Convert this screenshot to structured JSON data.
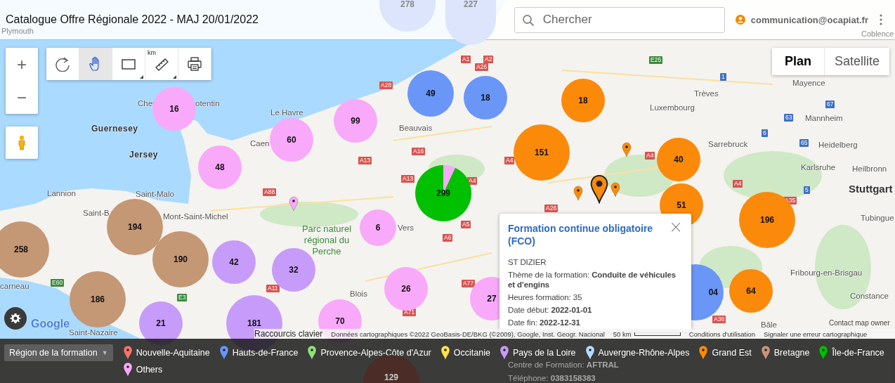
{
  "header": {
    "title": "Catalogue Offre Régionale 2022 - MAJ 20/01/2022",
    "search": {
      "placeholder": "Chercher"
    },
    "user": "communication@ocapiat.fr"
  },
  "map_controls": {
    "zoom_in": "+",
    "zoom_out": "−",
    "tools": [
      {
        "kind": "refresh",
        "selected": false
      },
      {
        "kind": "hand",
        "selected": true
      },
      {
        "kind": "rectangle",
        "selected": false
      },
      {
        "kind": "ruler",
        "label": "km",
        "selected": false
      },
      {
        "kind": "print",
        "selected": false
      }
    ],
    "map_types": [
      {
        "label": "Plan",
        "selected": true
      },
      {
        "label": "Satellite",
        "selected": false
      }
    ]
  },
  "map_labels": [
    {
      "kind": "faded_city",
      "text": "Plymouth"
    },
    {
      "kind": "faded_city",
      "text": "Coblence"
    },
    {
      "kind": "city",
      "text": "Mayence"
    },
    {
      "kind": "city",
      "text": "Trèves"
    },
    {
      "kind": "city",
      "text": "Cher"
    },
    {
      "kind": "city",
      "text": "otentin"
    },
    {
      "kind": "city",
      "text": "Le Havre"
    },
    {
      "kind": "city",
      "text": "Luxembourg"
    },
    {
      "kind": "city",
      "text": "Mannheim"
    },
    {
      "kind": "island",
      "text": "Guernesey"
    },
    {
      "kind": "city",
      "text": "Beauvais"
    },
    {
      "kind": "city",
      "text": "Caen"
    },
    {
      "kind": "city",
      "text": "Sarrebruck"
    },
    {
      "kind": "city",
      "text": "Heidelberg"
    },
    {
      "kind": "island",
      "text": "Jersey"
    },
    {
      "kind": "city",
      "text": "Karlsruhe"
    },
    {
      "kind": "city",
      "text": "Heilbronn"
    },
    {
      "kind": "city",
      "text": "Lannion"
    },
    {
      "kind": "city",
      "text": "Saint-Malo"
    },
    {
      "kind": "capital",
      "text": "Stuttgart"
    },
    {
      "kind": "city",
      "text": "Saint-B"
    },
    {
      "kind": "city",
      "text": "Mont-Saint-Michel"
    },
    {
      "kind": "city",
      "text": "Tubingue"
    },
    {
      "kind": "park",
      "text": "Parc naturel régional du Perche"
    },
    {
      "kind": "city",
      "text": "Vers"
    },
    {
      "kind": "city",
      "text": "Fribourg-en-Brisgau"
    },
    {
      "kind": "city",
      "text": "carneau"
    },
    {
      "kind": "city",
      "text": "Blois"
    },
    {
      "kind": "city",
      "text": "Constance"
    },
    {
      "kind": "city",
      "text": "Saint-Nazaire"
    },
    {
      "kind": "city",
      "text": "Bâle"
    }
  ],
  "road_shields": [
    {
      "kind": "road",
      "text": "A1"
    },
    {
      "kind": "road",
      "text": "A2"
    },
    {
      "kind": "euro",
      "text": "E25"
    },
    {
      "kind": "road",
      "text": "A26"
    },
    {
      "kind": "autobahn",
      "text": "1"
    },
    {
      "kind": "road",
      "text": "A28"
    },
    {
      "kind": "autobahn",
      "text": "67"
    },
    {
      "kind": "autobahn",
      "text": "63"
    },
    {
      "kind": "autobahn",
      "text": "6"
    },
    {
      "kind": "autobahn",
      "text": "65"
    },
    {
      "kind": "road",
      "text": "A16"
    },
    {
      "kind": "road",
      "text": "A13"
    },
    {
      "kind": "road",
      "text": "A4"
    },
    {
      "kind": "road",
      "text": "A4"
    },
    {
      "kind": "road",
      "text": "A13"
    },
    {
      "kind": "road",
      "text": "A4"
    },
    {
      "kind": "road",
      "text": "A4"
    },
    {
      "kind": "road",
      "text": "A88"
    },
    {
      "kind": "autobahn",
      "text": "5"
    },
    {
      "kind": "road",
      "text": "A35"
    },
    {
      "kind": "road",
      "text": "A26"
    },
    {
      "kind": "road",
      "text": "A5"
    },
    {
      "kind": "road",
      "text": "A6"
    },
    {
      "kind": "euro",
      "text": "E60"
    },
    {
      "kind": "road",
      "text": "A11"
    },
    {
      "kind": "road",
      "text": "A77"
    },
    {
      "kind": "euro",
      "text": "E3"
    },
    {
      "kind": "road",
      "text": "A71"
    },
    {
      "kind": "road",
      "text": "A36"
    }
  ],
  "clusters": [
    {
      "kind": "faded",
      "label": "278",
      "color": "#dce5fb"
    },
    {
      "kind": "faded",
      "label": "227",
      "color": "#dce5fb"
    },
    {
      "kind": "single",
      "label": "49",
      "color": "#6a96f8"
    },
    {
      "kind": "single",
      "label": "18",
      "color": "#6a96f8"
    },
    {
      "kind": "single",
      "label": "18",
      "color": "#fb8a0a"
    },
    {
      "kind": "single",
      "label": "16",
      "color": "#f9a9f9"
    },
    {
      "kind": "single",
      "label": "99",
      "color": "#f9a9f9"
    },
    {
      "kind": "single",
      "label": "60",
      "color": "#f9a9f9"
    },
    {
      "kind": "single",
      "label": "151",
      "color": "#fb8a0a"
    },
    {
      "kind": "single",
      "label": "40",
      "color": "#fb8a0a"
    },
    {
      "kind": "single",
      "label": "48",
      "color": "#f9a9f9"
    },
    {
      "kind": "pie",
      "label": "299",
      "slices": [
        {
          "color": "#00c000"
        },
        {
          "color": "#f9a9f9"
        }
      ]
    },
    {
      "kind": "single",
      "label": "51",
      "color": "#fb8a0a"
    },
    {
      "kind": "single",
      "label": "196",
      "color": "#fb8a0a"
    },
    {
      "kind": "single",
      "label": "194",
      "color": "#c49775"
    },
    {
      "kind": "single",
      "label": "6",
      "color": "#f9a9f9"
    },
    {
      "kind": "single",
      "label": "258",
      "color": "#c49775"
    },
    {
      "kind": "single",
      "label": "190",
      "color": "#c49775"
    },
    {
      "kind": "single",
      "label": "42",
      "color": "#c79bfa"
    },
    {
      "kind": "single",
      "label": "32",
      "color": "#c79bfa"
    },
    {
      "kind": "single",
      "label": "26",
      "color": "#f9a9f9"
    },
    {
      "kind": "single",
      "label": "04",
      "color": "#6a96f8"
    },
    {
      "kind": "single",
      "label": "64",
      "color": "#fb8a0a"
    },
    {
      "kind": "single",
      "label": "27",
      "color": "#f9a9f9"
    },
    {
      "kind": "single",
      "label": "186",
      "color": "#c49775"
    },
    {
      "kind": "single",
      "label": "21",
      "color": "#c79bfa"
    },
    {
      "kind": "single",
      "label": "181",
      "color": "#c79bfa"
    },
    {
      "kind": "single",
      "label": "70",
      "color": "#f9a9f9"
    },
    {
      "kind": "dimmed",
      "label": "129",
      "color": "#4b2c27"
    }
  ],
  "markers": [
    {
      "color": "#fb8a0a",
      "selected": false
    },
    {
      "color": "#fb8a0a",
      "selected": true
    },
    {
      "color": "#fb8a0a",
      "selected": false
    },
    {
      "color": "#fb8a0a",
      "selected": false
    },
    {
      "color": "#f9a9f9",
      "selected": false
    }
  ],
  "popup": {
    "title": "Formation continue obligatoire (FCO)",
    "close": "×",
    "lines": [
      "ST DIZIER",
      "Thème de la formation: **Conduite de véhicules et d'engins**",
      "Heures formation: 35",
      "Date début: **2022-01-01**",
      "Date fin: **2022-12-31**"
    ],
    "lines_behind_legend": [
      "Centre de Formation: **AFTRAL**",
      "Téléphone: **0383158383**"
    ]
  },
  "attribution": {
    "logo": "Google",
    "shortcuts": "Raccourcis clavier",
    "data": "Données cartographiques ©2022 GeoBasis-DE/BKG (©2009), Google, Inst. Geogr. Nacional",
    "scale": "50 km",
    "terms": "Conditions d'utilisation",
    "report": "Signaler une erreur cartographique",
    "contact": "Contact map owner"
  },
  "legend": {
    "dropdown": "Région de la formation",
    "caret": "▼",
    "items": [
      {
        "label": "Nouvelle-Aquitaine",
        "color": "#f07470"
      },
      {
        "label": "Hauts-de-France",
        "color": "#6b96f5"
      },
      {
        "label": "Provence-Alpes-Côte d'Azur",
        "color": "#8fe07a"
      },
      {
        "label": "Occitanie",
        "color": "#ffe14d"
      },
      {
        "label": "Pays de la Loire",
        "color": "#c39bf5"
      },
      {
        "label": "Auvergne-Rhône-Alpes",
        "color": "#b8dcff"
      },
      {
        "label": "Grand Est",
        "color": "#f98a0a"
      },
      {
        "label": "Bretagne",
        "color": "#c4967a"
      },
      {
        "label": "Île-de-France",
        "color": "#00c000"
      },
      {
        "label": "Others",
        "color": "#f7a8f7"
      }
    ]
  }
}
